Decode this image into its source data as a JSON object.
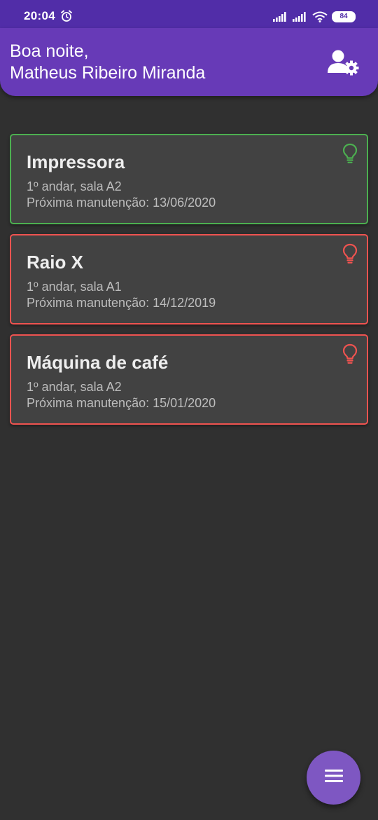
{
  "status_bar": {
    "time": "20:04",
    "battery_level": "84",
    "icons": [
      "alarm-icon",
      "cell-signal-icon",
      "cell-signal-icon",
      "wifi-icon",
      "battery-icon"
    ]
  },
  "header": {
    "greeting_line1": "Boa noite,",
    "greeting_line2": "Matheus Ribeiro Miranda",
    "action_icon": "user-settings-icon"
  },
  "equipment": [
    {
      "name": "Impressora",
      "location": "1º andar, sala A2",
      "maintenance": "Próxima manutenção: 13/06/2020",
      "status_color": "#4caf50"
    },
    {
      "name": "Raio X",
      "location": "1º andar, sala A1",
      "maintenance": "Próxima manutenção: 14/12/2019",
      "status_color": "#ef5350"
    },
    {
      "name": "Máquina de café",
      "location": "1º andar, sala A2",
      "maintenance": "Próxima manutenção: 15/01/2020",
      "status_color": "#ef5350"
    }
  ],
  "fab": {
    "icon": "menu-icon"
  },
  "colors": {
    "status_bar": "#512da8",
    "header": "#673ab7",
    "background": "#303030",
    "card": "#424242",
    "fab": "#7e57c2"
  }
}
